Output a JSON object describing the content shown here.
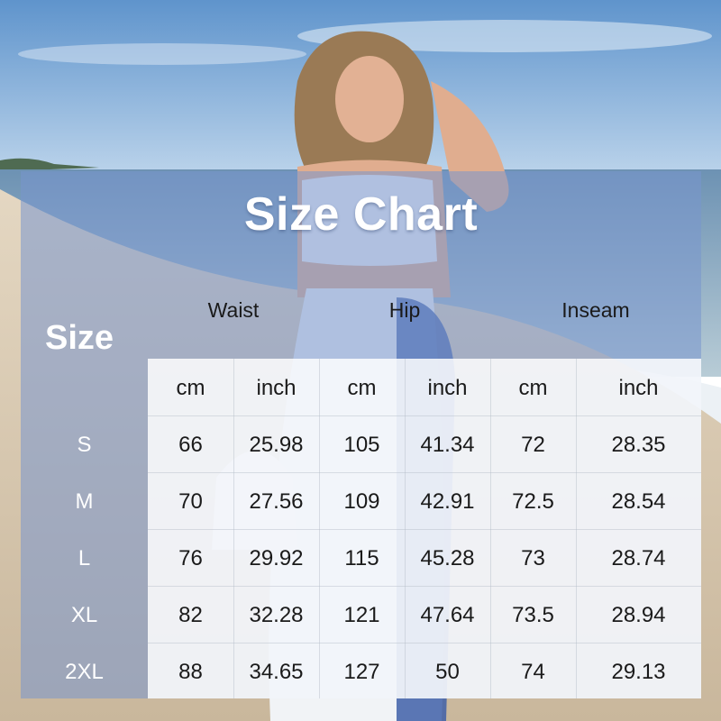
{
  "chart": {
    "title": "Size Chart",
    "size_label": "Size",
    "groups": [
      "Waist",
      "Hip",
      "Inseam"
    ],
    "units": [
      "cm",
      "inch",
      "cm",
      "inch",
      "cm",
      "inch"
    ],
    "rows": [
      {
        "size": "S",
        "values": [
          "66",
          "25.98",
          "105",
          "41.34",
          "72",
          "28.35"
        ]
      },
      {
        "size": "M",
        "values": [
          "70",
          "27.56",
          "109",
          "42.91",
          "72.5",
          "28.54"
        ]
      },
      {
        "size": "L",
        "values": [
          "76",
          "29.92",
          "115",
          "45.28",
          "73",
          "28.74"
        ]
      },
      {
        "size": "XL",
        "values": [
          "82",
          "32.28",
          "121",
          "47.64",
          "73.5",
          "28.94"
        ]
      },
      {
        "size": "2XL",
        "values": [
          "88",
          "34.65",
          "127",
          "50",
          "74",
          "29.13"
        ]
      }
    ]
  },
  "colors": {
    "sky_top": "#6f9fd0",
    "sea": "#7fa4c2",
    "sand": "#d9cbb5",
    "panel_tint": "#7896cd"
  }
}
